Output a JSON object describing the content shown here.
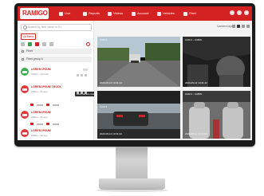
{
  "app": {
    "logo_text": "RAMIGO",
    "brand_color": "#d42121"
  },
  "topnav": {
    "items": [
      {
        "label": "Live",
        "icon": "map-pin-icon"
      },
      {
        "label": "Reports",
        "icon": "chart-icon"
      },
      {
        "label": "Videos",
        "icon": "video-icon"
      },
      {
        "label": "Account",
        "icon": "user-icon"
      },
      {
        "label": "Vehicles",
        "icon": "truck-icon"
      },
      {
        "label": "Fleet",
        "icon": "fleet-icon"
      }
    ]
  },
  "sidebar": {
    "search_placeholder": "Search by fleet name or ID",
    "chip_label": "All fleets",
    "group_1": "Fleet",
    "group_2": "Fleet group A",
    "vehicles": [
      {
        "name": "LOREM IPSUM",
        "sub": "Online • 14 km/h",
        "status": "online"
      },
      {
        "name": "LOREM IPSUM TRUCK",
        "sub": "Offline • 2h ago",
        "status": "offline"
      },
      {
        "name": "LOREM IPSUM",
        "sub": "Offline • 5h ago",
        "status": "offline"
      },
      {
        "name": "LOREM IPSUM",
        "sub": "Offline • 1d ago",
        "status": "offline"
      }
    ],
    "tooltip": "Live camera view"
  },
  "main": {
    "layout_label": "Camera layout"
  },
  "feeds": [
    {
      "label": "CAM 1",
      "timestamp": "2023-05-12 10:41:22"
    },
    {
      "label": "CAM 2 - CABIN",
      "timestamp": "2023-05-12 10:41:22"
    },
    {
      "label": "CAM 3",
      "timestamp": "2023-05-12 10:41:22"
    },
    {
      "label": "CAM 4 - CABIN",
      "timestamp": "2023-05-12 10:41:22"
    }
  ]
}
